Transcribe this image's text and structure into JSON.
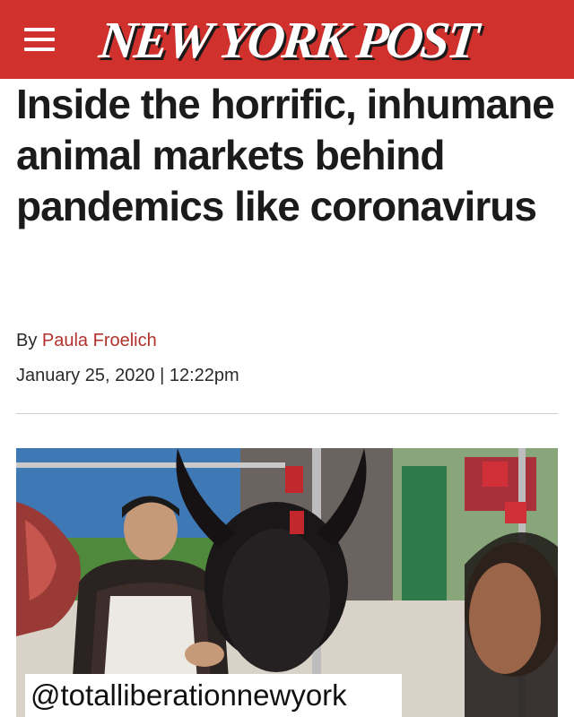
{
  "header": {
    "logo_text": "NEW YORK POST",
    "brand_color": "#d0312d",
    "menu_icon": "hamburger-menu-icon"
  },
  "article": {
    "headline": "Inside the horrific, inhumane animal markets behind pandemics like coronavirus",
    "byline_prefix": "By",
    "author": "Paula Froelich",
    "date": "January 25, 2020 | 12:22pm"
  },
  "overlay": {
    "handle": "@totalliberationnewyork"
  }
}
